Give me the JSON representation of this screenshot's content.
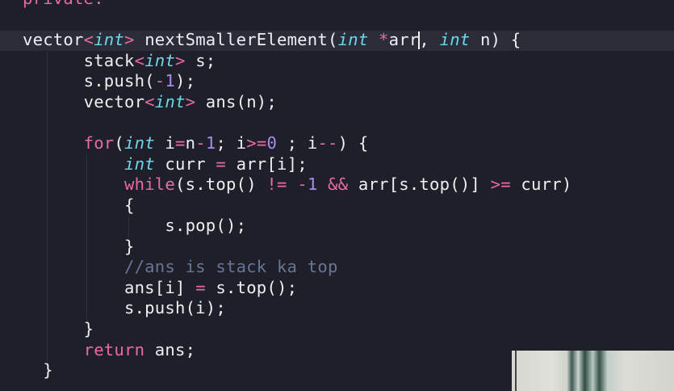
{
  "editor": {
    "lines": [
      [
        [
          "private:",
          "kw"
        ]
      ],
      [],
      [
        [
          "vector",
          "pl"
        ],
        [
          "<",
          "op"
        ],
        [
          "int",
          "ty"
        ],
        [
          ">",
          "op"
        ],
        [
          " nextSmallerElement(",
          "pl"
        ],
        [
          "int",
          "ty"
        ],
        [
          " ",
          "pl"
        ],
        [
          "*",
          "op"
        ],
        [
          "arr",
          "pl"
        ],
        [
          "|cursor",
          "cur"
        ],
        [
          ", ",
          "pl"
        ],
        [
          "int",
          "ty"
        ],
        [
          " n) {",
          "pl"
        ]
      ],
      [
        [
          "      stack",
          "pl"
        ],
        [
          "<",
          "op"
        ],
        [
          "int",
          "ty"
        ],
        [
          ">",
          "op"
        ],
        [
          " s;",
          "pl"
        ]
      ],
      [
        [
          "      s.push(",
          "pl"
        ],
        [
          "-",
          "op"
        ],
        [
          "1",
          "nu"
        ],
        [
          ");",
          "pl"
        ]
      ],
      [
        [
          "      vector",
          "pl"
        ],
        [
          "<",
          "op"
        ],
        [
          "int",
          "ty"
        ],
        [
          ">",
          "op"
        ],
        [
          " ans(n);",
          "pl"
        ]
      ],
      [],
      [
        [
          "      ",
          "pl"
        ],
        [
          "for",
          "kw"
        ],
        [
          "(",
          "pl"
        ],
        [
          "int",
          "ty"
        ],
        [
          " i",
          "pl"
        ],
        [
          "=",
          "op"
        ],
        [
          "n",
          "pl"
        ],
        [
          "-",
          "op"
        ],
        [
          "1",
          "nu"
        ],
        [
          "; i",
          "pl"
        ],
        [
          ">=",
          "op"
        ],
        [
          "0",
          "nu"
        ],
        [
          " ; i",
          "pl"
        ],
        [
          "--",
          "op"
        ],
        [
          ") {",
          "pl"
        ]
      ],
      [
        [
          "          ",
          "pl"
        ],
        [
          "int",
          "ty"
        ],
        [
          " curr ",
          "pl"
        ],
        [
          "=",
          "op"
        ],
        [
          " arr[i];",
          "pl"
        ]
      ],
      [
        [
          "          ",
          "pl"
        ],
        [
          "while",
          "kw"
        ],
        [
          "(s.top() ",
          "pl"
        ],
        [
          "!=",
          "op"
        ],
        [
          " ",
          "pl"
        ],
        [
          "-",
          "op"
        ],
        [
          "1",
          "nu"
        ],
        [
          " ",
          "pl"
        ],
        [
          "&&",
          "op"
        ],
        [
          " arr[s.top()] ",
          "pl"
        ],
        [
          ">=",
          "op"
        ],
        [
          " curr)",
          "pl"
        ]
      ],
      [
        [
          "          {",
          "pl"
        ]
      ],
      [
        [
          "              s.pop();",
          "pl"
        ]
      ],
      [
        [
          "          }",
          "pl"
        ]
      ],
      [
        [
          "          //ans is stack ka top",
          "cm"
        ]
      ],
      [
        [
          "          ans[i] ",
          "pl"
        ],
        [
          "=",
          "op"
        ],
        [
          " s.top();",
          "pl"
        ]
      ],
      [
        [
          "          s.push(i);",
          "pl"
        ]
      ],
      [
        [
          "      }",
          "pl"
        ]
      ],
      [
        [
          "      ",
          "pl"
        ],
        [
          "return",
          "kw"
        ],
        [
          " ans;",
          "pl"
        ]
      ],
      [
        [
          "  }",
          "pl"
        ]
      ]
    ]
  }
}
